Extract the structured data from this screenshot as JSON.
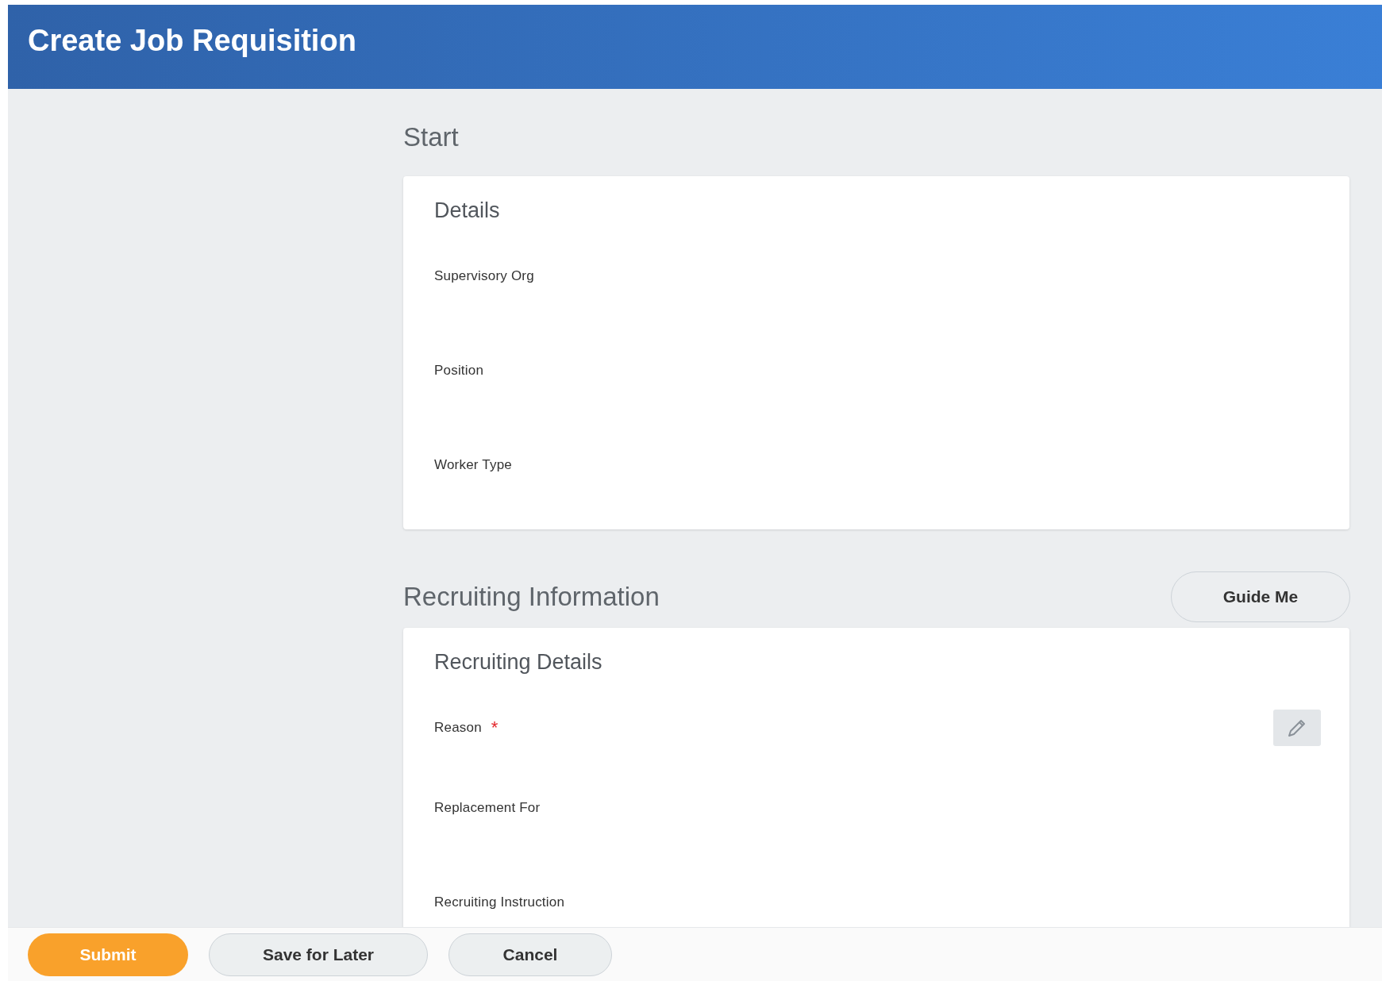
{
  "window": {
    "title": "Create Job Requisition"
  },
  "sections": [
    {
      "title": "Start",
      "card": {
        "title": "Details",
        "fields": [
          {
            "label": "Supervisory Org",
            "editable": false
          },
          {
            "label": "Position",
            "editable": false
          },
          {
            "label": "Worker Type",
            "editable": false
          }
        ]
      }
    },
    {
      "title": "Recruiting Information",
      "action": "Guide Me",
      "card": {
        "title": "Recruiting Details",
        "fields": [
          {
            "label": "Reason",
            "required_mark": "*",
            "editable": true
          },
          {
            "label": "Replacement For",
            "editable": false
          },
          {
            "label": "Recruiting Instruction",
            "editable": false
          }
        ]
      }
    }
  ],
  "buttons": [
    {
      "label": "Submit",
      "kind": "primary"
    },
    {
      "label": "Save for Later",
      "kind": "secondary"
    },
    {
      "label": "Cancel",
      "kind": "secondary"
    }
  ]
}
